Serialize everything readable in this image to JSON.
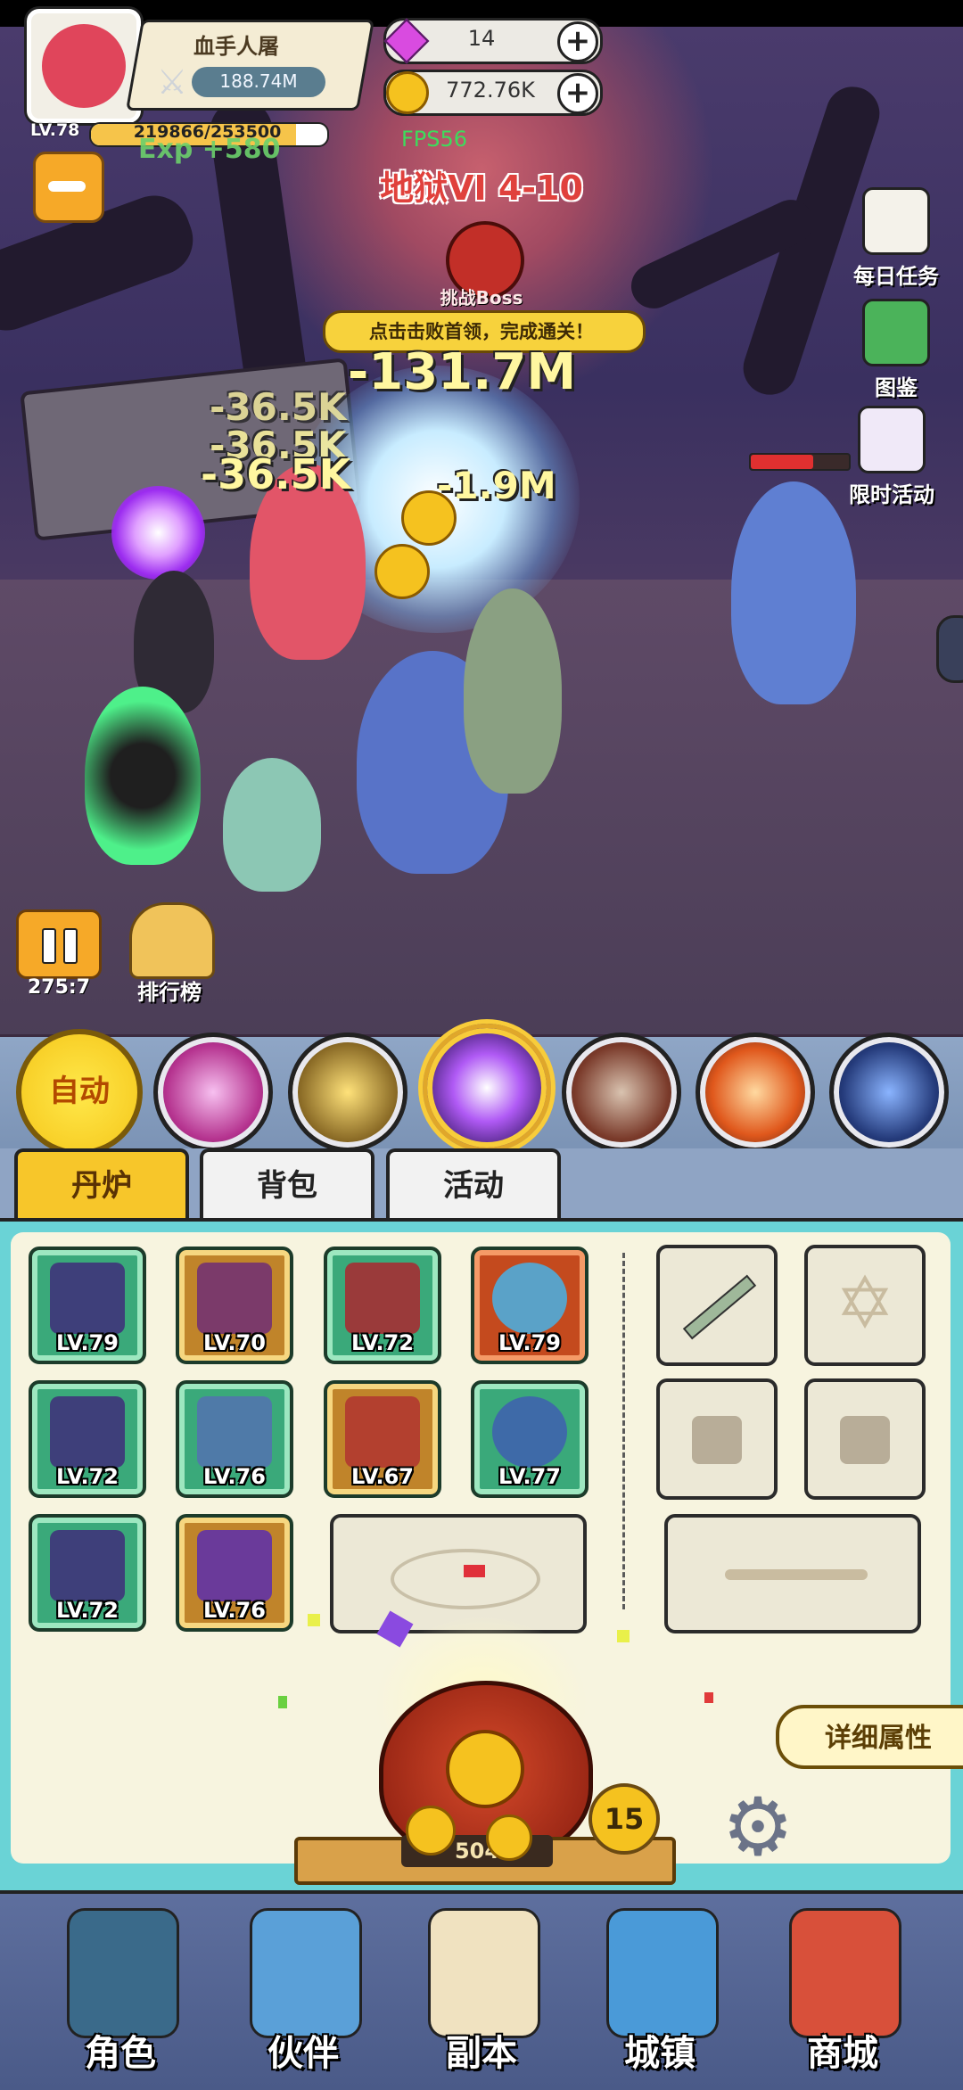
{
  "player": {
    "name": "血手人屠",
    "power": "188.74M",
    "level": "LV.78",
    "exp": "219866/253500",
    "exp_progress": 0.867,
    "exp_gain": "Exp +580"
  },
  "currency": {
    "gems": "14",
    "coins": "772.76K"
  },
  "debug": {
    "fps": "FPS56"
  },
  "stage": {
    "title": "地狱VI 4-10",
    "boss_button_label": "挑战Boss",
    "boss_hint": "点击击败首领，完成通关！"
  },
  "damage_numbers": [
    "-131.7M",
    "-36.5K",
    "-36.5K",
    "-36.5K",
    "-1.9M"
  ],
  "side_menu": [
    {
      "label": "每日任务",
      "icon": "daily-task-icon"
    },
    {
      "label": "图鉴",
      "icon": "codex-book-icon"
    },
    {
      "label": "限时活动",
      "icon": "limited-event-icon"
    }
  ],
  "battle_controls": {
    "speed": "275:7",
    "ranking_label": "排行榜"
  },
  "skills": {
    "auto_label": "自动",
    "skill_icons": [
      "pink-vortex-skill-icon",
      "golden-swords-skill-icon",
      "purple-orb-skill-icon",
      "beast-skill-icon",
      "fire-tornado-skill-icon",
      "blue-rune-skill-icon"
    ],
    "active_index": 2
  },
  "tabs": [
    {
      "label": "丹炉",
      "active": true
    },
    {
      "label": "背包",
      "active": false
    },
    {
      "label": "活动",
      "active": false
    }
  ],
  "inventory": [
    {
      "level": "LV.79",
      "icon": "trident-spear-icon",
      "quality": "green"
    },
    {
      "level": "LV.70",
      "icon": "crown-icon",
      "quality": "gold"
    },
    {
      "level": "LV.72",
      "icon": "armor-icon",
      "quality": "green"
    },
    {
      "level": "LV.79",
      "icon": "dragon-orb-icon",
      "quality": "red"
    },
    {
      "level": "LV.72",
      "icon": "jade-sword-icon",
      "quality": "green"
    },
    {
      "level": "LV.76",
      "icon": "dragon-mirror-icon",
      "quality": "green"
    },
    {
      "level": "LV.67",
      "icon": "heart-charm-icon",
      "quality": "gold"
    },
    {
      "level": "LV.77",
      "icon": "dragon-orb-blue-icon",
      "quality": "green"
    },
    {
      "level": "LV.72",
      "icon": "bow-icon",
      "quality": "green"
    },
    {
      "level": "LV.76",
      "icon": "helmet-icon",
      "quality": "gold"
    }
  ],
  "equipment_slots": [
    "sword-slot-icon",
    "hexagram-slot-icon",
    "lock-icon",
    "lock-icon"
  ],
  "furnace": {
    "detail_label": "详细属性",
    "count": "504",
    "level": "15"
  },
  "bottom_nav": [
    {
      "label": "角色",
      "icon": "character-icon"
    },
    {
      "label": "伙伴",
      "icon": "partner-icon"
    },
    {
      "label": "副本",
      "icon": "dungeon-scroll-icon"
    },
    {
      "label": "城镇",
      "icon": "town-icon"
    },
    {
      "label": "商城",
      "icon": "shop-icon"
    }
  ]
}
